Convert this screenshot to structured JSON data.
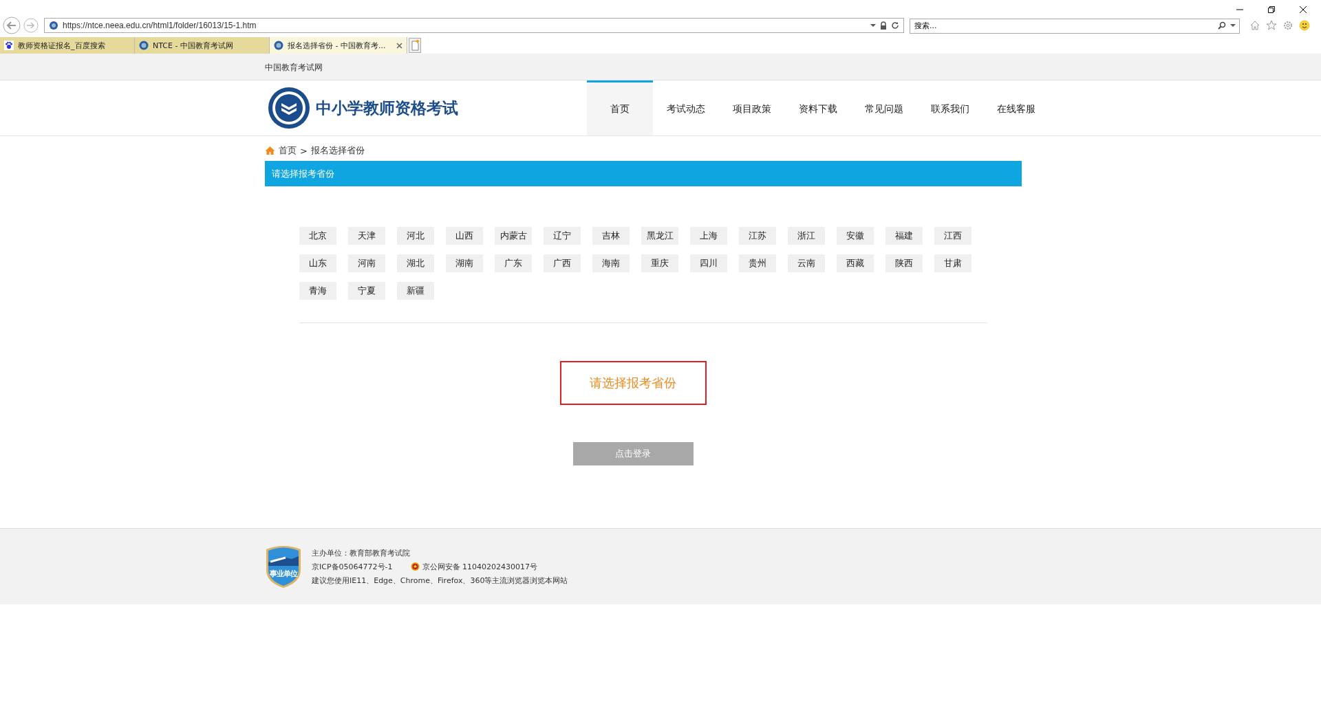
{
  "browser": {
    "url": "https://ntce.neea.edu.cn/html1/folder/16013/15-1.htm",
    "search": {
      "placeholder": "搜索..."
    },
    "tabs": [
      {
        "label": "教师资格证报名_百度搜索",
        "selected": false,
        "kind": "paw"
      },
      {
        "label": "NTCE - 中国教育考试网",
        "selected": false,
        "kind": "seal"
      },
      {
        "label": "报名选择省份 - 中国教育考...",
        "selected": true,
        "kind": "seal"
      }
    ]
  },
  "site_bar": {
    "title": "中国教育考试网"
  },
  "header": {
    "logo_text": "中小学教师资格考试",
    "nav": [
      {
        "label": "首页",
        "selected": true
      },
      {
        "label": "考试动态",
        "selected": false
      },
      {
        "label": "项目政策",
        "selected": false
      },
      {
        "label": "资料下载",
        "selected": false
      },
      {
        "label": "常见问题",
        "selected": false
      },
      {
        "label": "联系我们",
        "selected": false
      },
      {
        "label": "在线客服",
        "selected": false
      }
    ]
  },
  "breadcrumb": [
    "首页",
    "报名选择省份"
  ],
  "breadcrumb_separator": ">",
  "section_title": "请选择报考省份",
  "provinces": [
    "北京",
    "天津",
    "河北",
    "山西",
    "内蒙古",
    "辽宁",
    "吉林",
    "黑龙江",
    "上海",
    "江苏",
    "浙江",
    "安徽",
    "福建",
    "江西",
    "山东",
    "河南",
    "湖北",
    "湖南",
    "广东",
    "广西",
    "海南",
    "重庆",
    "四川",
    "贵州",
    "云南",
    "西藏",
    "陕西",
    "甘肃",
    "青海",
    "宁夏",
    "新疆"
  ],
  "selection_prompt": "请选择报考省份",
  "login_button": {
    "label": "点击登录",
    "disabled": true
  },
  "footer": {
    "badge_text": "事业单位",
    "lines": [
      "主办单位：教育部教育考试院"
    ],
    "icp": "京ICP备05064772号-1",
    "police": "京公网安备 11040202430017号",
    "advice": "建议您使用IE11、Edge、Chrome、Firefox、360等主流浏览器浏览本网站"
  }
}
